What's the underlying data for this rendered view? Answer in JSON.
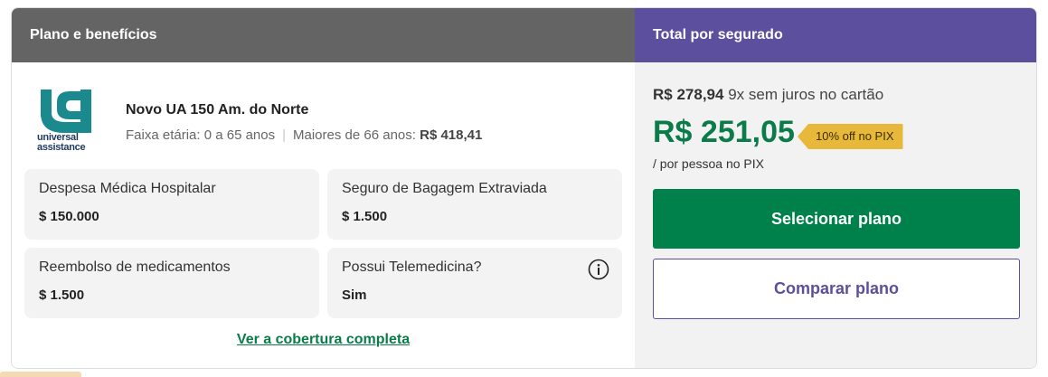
{
  "header": {
    "left_title": "Plano e benefícios",
    "right_title": "Total por segurado"
  },
  "plan": {
    "logo_text_line1": "universal",
    "logo_text_line2": "assistance",
    "name": "Novo UA 150 Am. do Norte",
    "age_range": "Faixa etária: 0 a 65 anos",
    "over_66_label": "Maiores de 66 anos:",
    "over_66_price": "R$ 418,41"
  },
  "benefits": [
    {
      "label": "Despesa Médica Hospitalar",
      "value": "$ 150.000"
    },
    {
      "label": "Seguro de Bagagem Extraviada",
      "value": "$ 1.500"
    },
    {
      "label": "Reembolso de medicamentos",
      "value": "$ 1.500"
    },
    {
      "label": "Possui Telemedicina?",
      "value": "Sim"
    }
  ],
  "coverage_link": "Ver a cobertura completa",
  "pricing": {
    "card_price": "R$ 278,94",
    "card_terms": "9x sem juros no cartão",
    "pix_price": "R$ 251,05",
    "discount_badge": "10% off no PIX",
    "per_person": "/ por pessoa no PIX"
  },
  "actions": {
    "select_label": "Selecionar plano",
    "compare_label": "Comparar plano"
  },
  "colors": {
    "left_header": "#646464",
    "right_header": "#5b4f9e",
    "accent_green": "#0b7b4a",
    "button_green": "#00804a",
    "badge_yellow": "#e7b83a",
    "logo_teal": "#1b8a8f"
  },
  "icons": {
    "telemedicine_info": "info-icon",
    "brand_logo": "universal-assistance-logo"
  }
}
